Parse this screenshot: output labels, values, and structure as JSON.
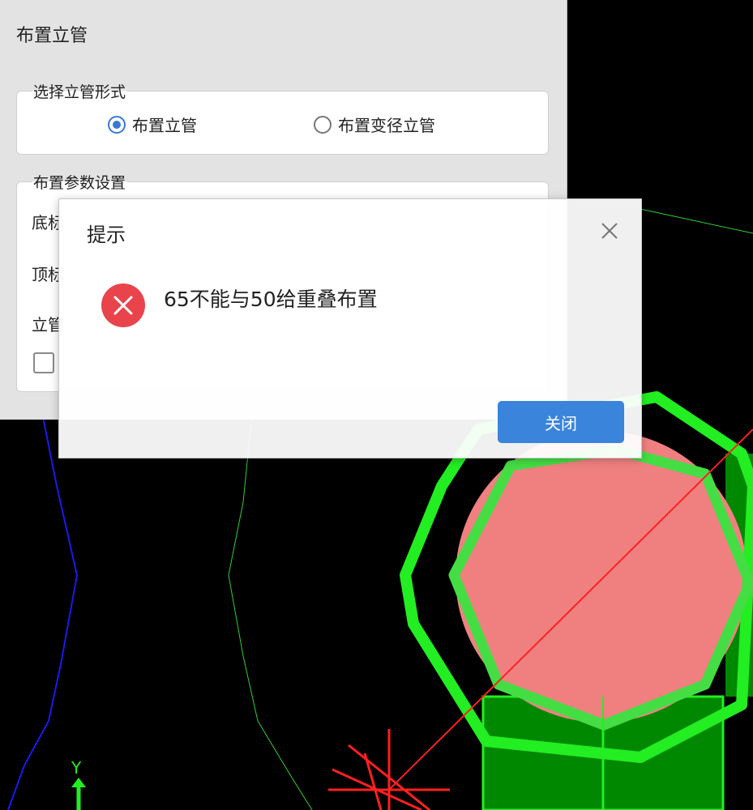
{
  "panel": {
    "title": "布置立管",
    "pipe_form_group": {
      "legend": "选择立管形式",
      "options": [
        {
          "label": "布置立管",
          "checked": true
        },
        {
          "label": "布置变径立管",
          "checked": false
        }
      ]
    },
    "params_group": {
      "legend": "布置参数设置",
      "labels": [
        "底标",
        "顶标",
        "立管"
      ]
    }
  },
  "dialog": {
    "title": "提示",
    "message": "65不能与50给重叠布置",
    "close_button": "关闭",
    "icons": {
      "close": "close-icon",
      "status": "error-icon"
    }
  },
  "canvas": {
    "axis_label": "Y",
    "colors": {
      "background": "#000000",
      "pipe_outline": "#22ee22",
      "pipe_fill": "#008800",
      "highlight": "#f08080",
      "guide_red": "#ff2020",
      "guide_blue": "#1a1aee"
    }
  },
  "colors": {
    "accent": "#3a84dc",
    "error": "#e9444b"
  }
}
